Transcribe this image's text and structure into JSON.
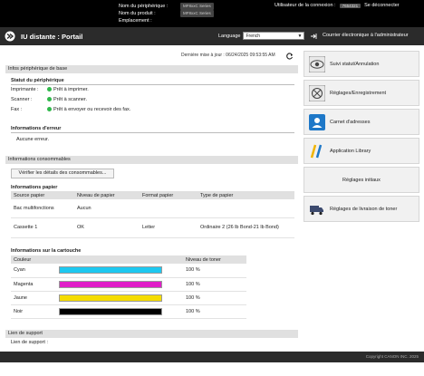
{
  "header": {
    "printer_name_label": "Nom du périphérique :",
    "printer_name_value": "MF8xxC Series",
    "product_name_label": "Nom du produit :",
    "product_name_value": "MF8xxC Series",
    "location_label": "Emplacement :",
    "user_label": "Utilisateur de la connexion :",
    "user_value": "7654321",
    "logout": "Se déconnecter"
  },
  "titlebar": {
    "title": "IU distante : Portail",
    "language_label": "Language",
    "language_value": "French",
    "mail_admin": "Courrier électronique à l'administrateur"
  },
  "main": {
    "last_updated": "Dernière mise à jour : 06/24/2025 09:53:55 AM",
    "basic_info_header": "Infos périphérique de base",
    "device_status_title": "Statut du périphérique",
    "printer_label": "Imprimante :",
    "printer_status": "Prêt à imprimer.",
    "scanner_label": "Scanner :",
    "scanner_status": "Prêt à scanner.",
    "fax_label": "Fax :",
    "fax_status": "Prêt à envoyer ou recevoir des fax.",
    "error_info_title": "Informations d'erreur",
    "error_info_value": "Aucune erreur.",
    "consumables_header": "Informations consommables",
    "check_consumables_button": "Vérifier les détails des consommables...",
    "paper_info_title": "Informations papier",
    "paper_table": {
      "headers": [
        "Source papier",
        "Niveau de papier",
        "Format papier",
        "Type de papier"
      ],
      "rows": [
        [
          "Bac multifonctions",
          "Aucun",
          "",
          ""
        ],
        [
          "Cassette 1",
          "OK",
          "Letter",
          "Ordinaire 2 (26 lb Bond-21 lb Bond)"
        ]
      ]
    },
    "cartridge_info_title": "Informations sur la cartouche",
    "toner_table": {
      "headers": [
        "Couleur",
        "",
        "Niveau de toner"
      ],
      "rows": [
        {
          "color": "Cyan",
          "level": "100 %",
          "fill": 1.0,
          "hex": "#1ec8f0"
        },
        {
          "color": "Magenta",
          "level": "100 %",
          "fill": 1.0,
          "hex": "#e01ec8"
        },
        {
          "color": "Jaune",
          "level": "100 %",
          "fill": 1.0,
          "hex": "#f5dc00"
        },
        {
          "color": "Noir",
          "level": "100 %",
          "fill": 1.0,
          "hex": "#000000"
        }
      ]
    },
    "support_header": "Lien de support",
    "support_label": "Lien de support :"
  },
  "sidebar": {
    "items": [
      {
        "label": "Suivi statut/Annulation",
        "icon": "status-monitor-icon"
      },
      {
        "label": "Réglages/Enregistrement",
        "icon": "settings-icon"
      },
      {
        "label": "Carnet d'adresses",
        "icon": "address-book-icon"
      },
      {
        "label": "Application Library",
        "icon": "application-library-icon"
      },
      {
        "label": "Réglages initiaux",
        "icon": ""
      },
      {
        "label": "Réglages de livraison de toner",
        "icon": "toner-delivery-icon"
      }
    ]
  },
  "footer": {
    "copyright": "Copyright CANON INC. 2025"
  },
  "colors": {
    "header_bg": "#000000",
    "titlebar_bg": "#2b2b2b",
    "status_green": "#2fb84a",
    "section_bg": "#e0e0e0"
  }
}
